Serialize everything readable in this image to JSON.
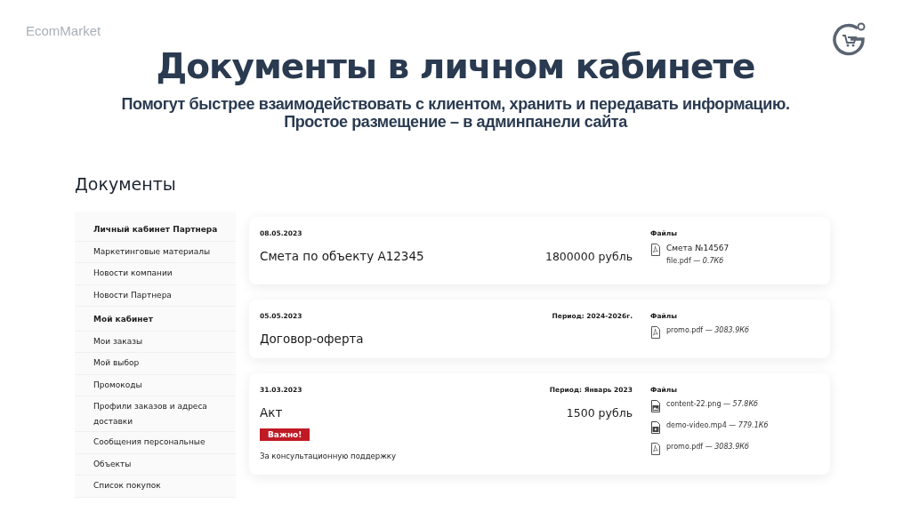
{
  "brand": "EcomMarket",
  "headline": "Документы в личном кабинете",
  "subtitle_lines": [
    "Помогут быстрее взаимодействовать с клиентом, хранить и передавать информацию.",
    "Простое размещение – в админпанели сайта"
  ],
  "section_title": "Документы",
  "sidebar": {
    "items": [
      {
        "kind": "heading",
        "label": "Личный кабинет Партнера"
      },
      {
        "kind": "link",
        "label": "Маркетинговые материалы"
      },
      {
        "kind": "link",
        "label": "Новости компании"
      },
      {
        "kind": "link",
        "label": "Новости Партнера"
      },
      {
        "kind": "heading",
        "label": "Мой кабинет"
      },
      {
        "kind": "link",
        "label": "Мои заказы"
      },
      {
        "kind": "link",
        "label": "Мой выбор"
      },
      {
        "kind": "link",
        "label": "Промокоды"
      },
      {
        "kind": "link",
        "label": "Профили заказов и адреса доставки"
      },
      {
        "kind": "link",
        "label": "Сообщения персональные"
      },
      {
        "kind": "link",
        "label": "Объекты"
      },
      {
        "kind": "link",
        "label": "Список покупок"
      }
    ]
  },
  "documents": [
    {
      "date": "08.05.2023",
      "title": "Смета по объекту А12345",
      "amount": "1800000 рубль",
      "files_label": "Файлы",
      "files": [
        {
          "kind": "pdf",
          "title": "Смета №14567",
          "meta": "file.pdf — *0.7Кб*"
        }
      ]
    },
    {
      "date": "05.05.2023",
      "period": "Период: 2024-2026г.",
      "title": "Договор-оферта",
      "files_label": "Файлы",
      "files": [
        {
          "kind": "pdf",
          "meta": "promo.pdf — *3083.9Кб*"
        }
      ]
    },
    {
      "date": "31.03.2023",
      "period": "Период: Январь 2023",
      "title": "Акт",
      "amount": "1500 рубль",
      "badge": "Важно!",
      "note": "За консультационную поддержку",
      "files_label": "Файлы",
      "files": [
        {
          "kind": "image",
          "meta": "content-22.png — *57.8Кб*"
        },
        {
          "kind": "video",
          "meta": "demo-video.mp4 — *779.1Кб*"
        },
        {
          "kind": "pdf",
          "meta": "promo.pdf — *3083.9Кб*"
        }
      ]
    }
  ]
}
